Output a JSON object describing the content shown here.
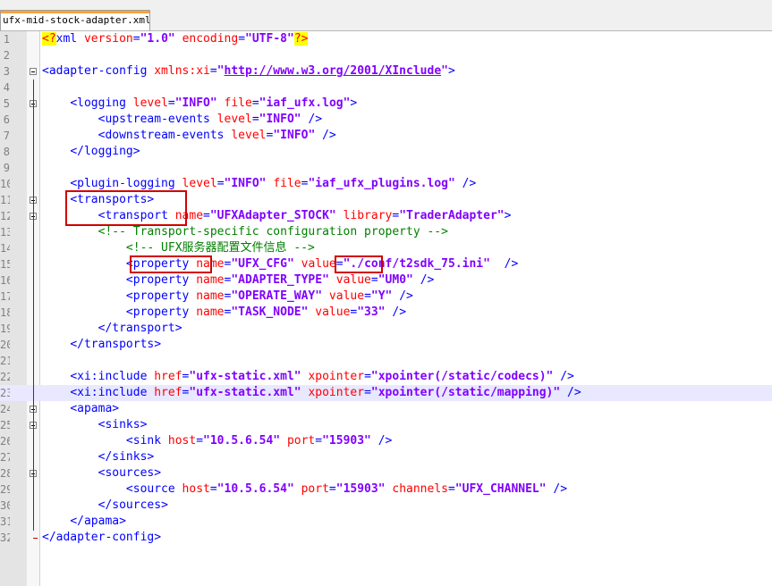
{
  "tab": {
    "label": "ufx-mid-stock-adapter.xml"
  },
  "lines": [
    {
      "num": "1",
      "tokens": [
        [
          "pi",
          "<?"
        ],
        [
          "tag",
          "xml "
        ],
        [
          "attr",
          "version"
        ],
        [
          "tag",
          "="
        ],
        [
          "val",
          "\"1.0\""
        ],
        [
          "text",
          " "
        ],
        [
          "attr",
          "encoding"
        ],
        [
          "tag",
          "="
        ],
        [
          "val",
          "\"UTF-8\""
        ],
        [
          "pi",
          "?>"
        ]
      ]
    },
    {
      "num": "2",
      "tokens": []
    },
    {
      "num": "3",
      "tokens": [
        [
          "tag",
          "<adapter-config "
        ],
        [
          "attr",
          "xmlns:xi"
        ],
        [
          "tag",
          "="
        ],
        [
          "val",
          "\""
        ],
        [
          "link",
          "http://www.w3.org/2001/XInclude"
        ],
        [
          "val",
          "\""
        ],
        [
          "tag",
          ">"
        ]
      ]
    },
    {
      "num": "4",
      "tokens": []
    },
    {
      "num": "5",
      "tokens": [
        [
          "text",
          "    "
        ],
        [
          "tag",
          "<logging "
        ],
        [
          "attr",
          "level"
        ],
        [
          "tag",
          "="
        ],
        [
          "val",
          "\"INFO\""
        ],
        [
          "text",
          " "
        ],
        [
          "attr",
          "file"
        ],
        [
          "tag",
          "="
        ],
        [
          "val",
          "\"iaf_ufx.log\""
        ],
        [
          "tag",
          ">"
        ]
      ]
    },
    {
      "num": "6",
      "tokens": [
        [
          "text",
          "        "
        ],
        [
          "tag",
          "<upstream-events "
        ],
        [
          "attr",
          "level"
        ],
        [
          "tag",
          "="
        ],
        [
          "val",
          "\"INFO\""
        ],
        [
          "text",
          " "
        ],
        [
          "tag",
          "/>"
        ]
      ]
    },
    {
      "num": "7",
      "tokens": [
        [
          "text",
          "        "
        ],
        [
          "tag",
          "<downstream-events "
        ],
        [
          "attr",
          "level"
        ],
        [
          "tag",
          "="
        ],
        [
          "val",
          "\"INFO\""
        ],
        [
          "text",
          " "
        ],
        [
          "tag",
          "/>"
        ]
      ]
    },
    {
      "num": "8",
      "tokens": [
        [
          "text",
          "    "
        ],
        [
          "tag",
          "</logging>"
        ]
      ]
    },
    {
      "num": "9",
      "tokens": []
    },
    {
      "num": "10",
      "tokens": [
        [
          "text",
          "    "
        ],
        [
          "tag",
          "<plugin-logging "
        ],
        [
          "attr",
          "level"
        ],
        [
          "tag",
          "="
        ],
        [
          "val",
          "\"INFO\""
        ],
        [
          "text",
          " "
        ],
        [
          "attr",
          "file"
        ],
        [
          "tag",
          "="
        ],
        [
          "val",
          "\"iaf_ufx_plugins.log\""
        ],
        [
          "text",
          " "
        ],
        [
          "tag",
          "/>"
        ]
      ]
    },
    {
      "num": "11",
      "tokens": [
        [
          "text",
          "    "
        ],
        [
          "tag",
          "<transports>"
        ]
      ]
    },
    {
      "num": "12",
      "tokens": [
        [
          "text",
          "        "
        ],
        [
          "tag",
          "<transport "
        ],
        [
          "attr",
          "name"
        ],
        [
          "tag",
          "="
        ],
        [
          "val",
          "\"UFXAdapter_STOCK\""
        ],
        [
          "text",
          " "
        ],
        [
          "attr",
          "library"
        ],
        [
          "tag",
          "="
        ],
        [
          "val",
          "\"TraderAdapter\""
        ],
        [
          "tag",
          ">"
        ]
      ]
    },
    {
      "num": "13",
      "tokens": [
        [
          "text",
          "        "
        ],
        [
          "com",
          "<!-- Transport-specific configuration property -->"
        ]
      ]
    },
    {
      "num": "14",
      "tokens": [
        [
          "text",
          "            "
        ],
        [
          "com",
          "<!-- UFX服务器配置文件信息 -->"
        ]
      ]
    },
    {
      "num": "15",
      "tokens": [
        [
          "text",
          "            "
        ],
        [
          "tag",
          "<property "
        ],
        [
          "attr",
          "name"
        ],
        [
          "tag",
          "="
        ],
        [
          "val",
          "\"UFX_CFG\""
        ],
        [
          "text",
          " "
        ],
        [
          "attr",
          "value"
        ],
        [
          "tag",
          "="
        ],
        [
          "val",
          "\"./conf/t2sdk_75.ini\""
        ],
        [
          "text",
          "  "
        ],
        [
          "tag",
          "/>"
        ]
      ]
    },
    {
      "num": "16",
      "tokens": [
        [
          "text",
          "            "
        ],
        [
          "tag",
          "<property "
        ],
        [
          "attr",
          "name"
        ],
        [
          "tag",
          "="
        ],
        [
          "val",
          "\"ADAPTER_TYPE\""
        ],
        [
          "text",
          " "
        ],
        [
          "attr",
          "value"
        ],
        [
          "tag",
          "="
        ],
        [
          "val",
          "\"UM0\""
        ],
        [
          "text",
          " "
        ],
        [
          "tag",
          "/>"
        ]
      ]
    },
    {
      "num": "17",
      "tokens": [
        [
          "text",
          "            "
        ],
        [
          "tag",
          "<property "
        ],
        [
          "attr",
          "name"
        ],
        [
          "tag",
          "="
        ],
        [
          "val",
          "\"OPERATE_WAY\""
        ],
        [
          "text",
          " "
        ],
        [
          "attr",
          "value"
        ],
        [
          "tag",
          "="
        ],
        [
          "val",
          "\"Y\""
        ],
        [
          "text",
          " "
        ],
        [
          "tag",
          "/>"
        ]
      ]
    },
    {
      "num": "18",
      "tokens": [
        [
          "text",
          "            "
        ],
        [
          "tag",
          "<property "
        ],
        [
          "attr",
          "name"
        ],
        [
          "tag",
          "="
        ],
        [
          "val",
          "\"TASK_NODE\""
        ],
        [
          "text",
          " "
        ],
        [
          "attr",
          "value"
        ],
        [
          "tag",
          "="
        ],
        [
          "val",
          "\"33\""
        ],
        [
          "text",
          " "
        ],
        [
          "tag",
          "/>"
        ]
      ]
    },
    {
      "num": "19",
      "tokens": [
        [
          "text",
          "        "
        ],
        [
          "tag",
          "</transport>"
        ]
      ]
    },
    {
      "num": "20",
      "tokens": [
        [
          "text",
          "    "
        ],
        [
          "tag",
          "</transports>"
        ]
      ]
    },
    {
      "num": "21",
      "tokens": []
    },
    {
      "num": "22",
      "tokens": [
        [
          "text",
          "    "
        ],
        [
          "tag",
          "<xi:include "
        ],
        [
          "attr",
          "href"
        ],
        [
          "tag",
          "="
        ],
        [
          "val",
          "\"ufx-static.xml\""
        ],
        [
          "text",
          " "
        ],
        [
          "attr",
          "xpointer"
        ],
        [
          "tag",
          "="
        ],
        [
          "val",
          "\"xpointer(/static/codecs)\""
        ],
        [
          "text",
          " "
        ],
        [
          "tag",
          "/>"
        ]
      ]
    },
    {
      "num": "23",
      "tokens": [
        [
          "text",
          "    "
        ],
        [
          "tag",
          "<xi:include "
        ],
        [
          "attr",
          "href"
        ],
        [
          "tag",
          "="
        ],
        [
          "val",
          "\"ufx-static.xml\""
        ],
        [
          "text",
          " "
        ],
        [
          "attr",
          "xpointer"
        ],
        [
          "tag",
          "="
        ],
        [
          "val",
          "\"xpointer(/static/mapping)\""
        ],
        [
          "text",
          " "
        ],
        [
          "tag",
          "/>"
        ]
      ]
    },
    {
      "num": "24",
      "tokens": [
        [
          "text",
          "    "
        ],
        [
          "tag",
          "<apama>"
        ]
      ]
    },
    {
      "num": "25",
      "tokens": [
        [
          "text",
          "        "
        ],
        [
          "tag",
          "<sinks>"
        ]
      ]
    },
    {
      "num": "26",
      "tokens": [
        [
          "text",
          "            "
        ],
        [
          "tag",
          "<sink "
        ],
        [
          "attr",
          "host"
        ],
        [
          "tag",
          "="
        ],
        [
          "val",
          "\"10.5.6.54\""
        ],
        [
          "text",
          " "
        ],
        [
          "attr",
          "port"
        ],
        [
          "tag",
          "="
        ],
        [
          "val",
          "\"15903\""
        ],
        [
          "text",
          " "
        ],
        [
          "tag",
          "/>"
        ]
      ]
    },
    {
      "num": "27",
      "tokens": [
        [
          "text",
          "        "
        ],
        [
          "tag",
          "</sinks>"
        ]
      ]
    },
    {
      "num": "28",
      "tokens": [
        [
          "text",
          "        "
        ],
        [
          "tag",
          "<sources>"
        ]
      ]
    },
    {
      "num": "29",
      "tokens": [
        [
          "text",
          "            "
        ],
        [
          "tag",
          "<source "
        ],
        [
          "attr",
          "host"
        ],
        [
          "tag",
          "="
        ],
        [
          "val",
          "\"10.5.6.54\""
        ],
        [
          "text",
          " "
        ],
        [
          "attr",
          "port"
        ],
        [
          "tag",
          "="
        ],
        [
          "val",
          "\"15903\""
        ],
        [
          "text",
          " "
        ],
        [
          "attr",
          "channels"
        ],
        [
          "tag",
          "="
        ],
        [
          "val",
          "\"UFX_CHANNEL\""
        ],
        [
          "text",
          " "
        ],
        [
          "tag",
          "/>"
        ]
      ]
    },
    {
      "num": "30",
      "tokens": [
        [
          "text",
          "        "
        ],
        [
          "tag",
          "</sources>"
        ]
      ]
    },
    {
      "num": "31",
      "tokens": [
        [
          "text",
          "    "
        ],
        [
          "tag",
          "</apama>"
        ]
      ]
    },
    {
      "num": "32",
      "tokens": [
        [
          "tag",
          "</adapter-config>"
        ]
      ]
    }
  ],
  "current_line": 23,
  "fold_lines": [
    3,
    5,
    11,
    12,
    24,
    25,
    28
  ],
  "colors": {
    "tag": "#0000ff",
    "attr": "#ff0000",
    "value": "#8000ff",
    "comment": "#008000",
    "highlight_box": "#d00000",
    "current_line": "#e8e8ff"
  }
}
